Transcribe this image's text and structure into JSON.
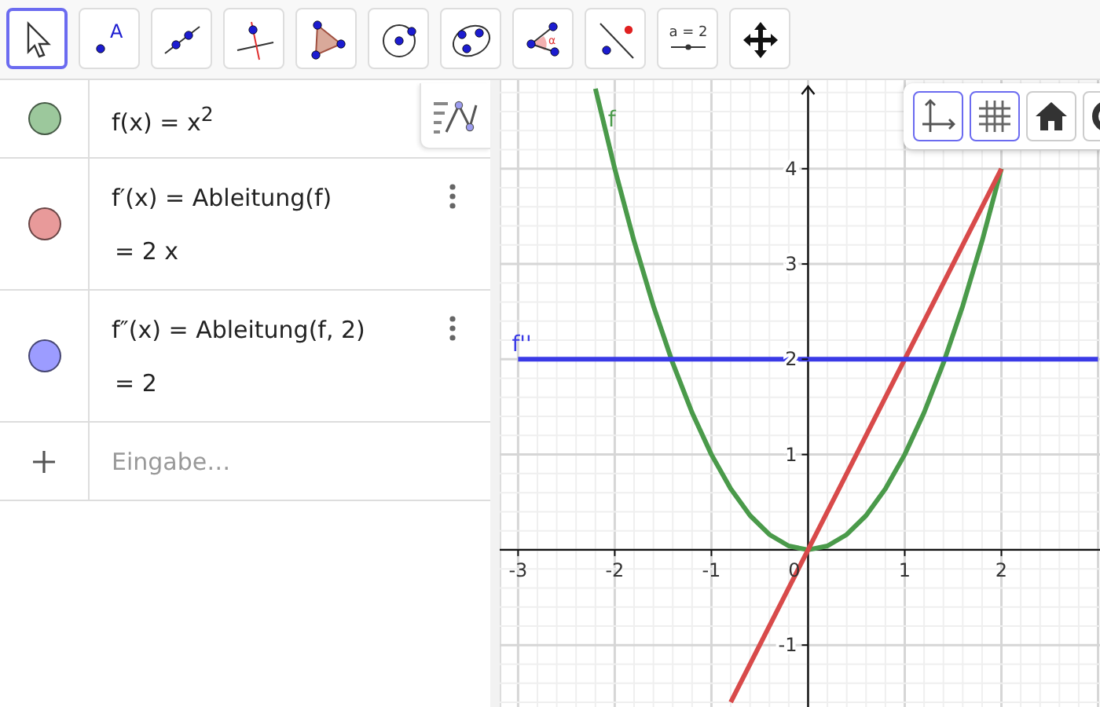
{
  "toolbar": {
    "tools": [
      {
        "kind": "move",
        "selected": true
      },
      {
        "kind": "point",
        "label": "A",
        "selected": false
      },
      {
        "kind": "line",
        "selected": false
      },
      {
        "kind": "perpendicular",
        "selected": false
      },
      {
        "kind": "polygon",
        "selected": false
      },
      {
        "kind": "circle",
        "selected": false
      },
      {
        "kind": "conic",
        "selected": false
      },
      {
        "kind": "angle",
        "label": "α",
        "selected": false
      },
      {
        "kind": "reflect",
        "selected": false
      },
      {
        "kind": "slider",
        "label": "a = 2",
        "selected": false
      },
      {
        "kind": "move-view",
        "selected": false
      }
    ]
  },
  "algebra": {
    "items": [
      {
        "color": "#9cc89c",
        "input": "f(x) = x$^{2}$"
      },
      {
        "color": "#e89a9a",
        "input": "f′(x) = Ableitung(f)",
        "output": "= 2 x"
      },
      {
        "color": "#9c9cff",
        "input": "f″(x) = Ableitung(f, 2)",
        "output": "= 2"
      }
    ],
    "input": {
      "placeholder": "Eingabe…"
    }
  },
  "graphics": {
    "style_bar": [
      {
        "kind": "axes",
        "selected": true
      },
      {
        "kind": "grid",
        "selected": true
      },
      {
        "kind": "home",
        "selected": false
      },
      {
        "kind": "more",
        "selected": false
      }
    ],
    "chart_data": {
      "type": "line",
      "xlim": [
        -3.19,
        3.02
      ],
      "ylim": [
        -1.65,
        4.93
      ],
      "xticks": [
        -3,
        -2,
        -1,
        1,
        2
      ],
      "yticks": [
        -1,
        1,
        2,
        3,
        4
      ],
      "x": [
        -3,
        -2.8,
        -2.6,
        -2.4,
        -2.2,
        -2,
        -1.8,
        -1.6,
        -1.4,
        -1.2,
        -1,
        -0.8,
        -0.6,
        -0.4,
        -0.2,
        0,
        0.2,
        0.4,
        0.6,
        0.8,
        1,
        1.2,
        1.4,
        1.6,
        1.8,
        2,
        2.2,
        2.4,
        2.6,
        2.8,
        3
      ],
      "series": [
        {
          "name": "f",
          "color": "#4a9a4a",
          "values": [
            null,
            null,
            null,
            null,
            4.84,
            4,
            3.24,
            2.56,
            1.96,
            1.44,
            1,
            0.64,
            0.36,
            0.16,
            0.04,
            0,
            0.04,
            0.16,
            0.36,
            0.64,
            1,
            1.44,
            1.96,
            2.56,
            3.24,
            4,
            null,
            null,
            null,
            null,
            null
          ]
        },
        {
          "color": "#d84a4a",
          "values": [
            null,
            null,
            null,
            null,
            null,
            null,
            null,
            null,
            null,
            null,
            null,
            -1.6,
            -1.2,
            -0.8,
            -0.4,
            0,
            0.4,
            0.8,
            1.2,
            1.6,
            2,
            2.4,
            2.8,
            3.2,
            3.6,
            4,
            null,
            null,
            null,
            null,
            null
          ]
        },
        {
          "name": "f''",
          "color": "#3a3ae6",
          "values": [
            2,
            2,
            2,
            2,
            2,
            2,
            2,
            2,
            2,
            2,
            2,
            2,
            2,
            2,
            2,
            2,
            2,
            2,
            2,
            2,
            2,
            2,
            2,
            2,
            2,
            2,
            2,
            2,
            2,
            2,
            2
          ]
        }
      ],
      "grid": true
    },
    "origin_label": "0"
  }
}
